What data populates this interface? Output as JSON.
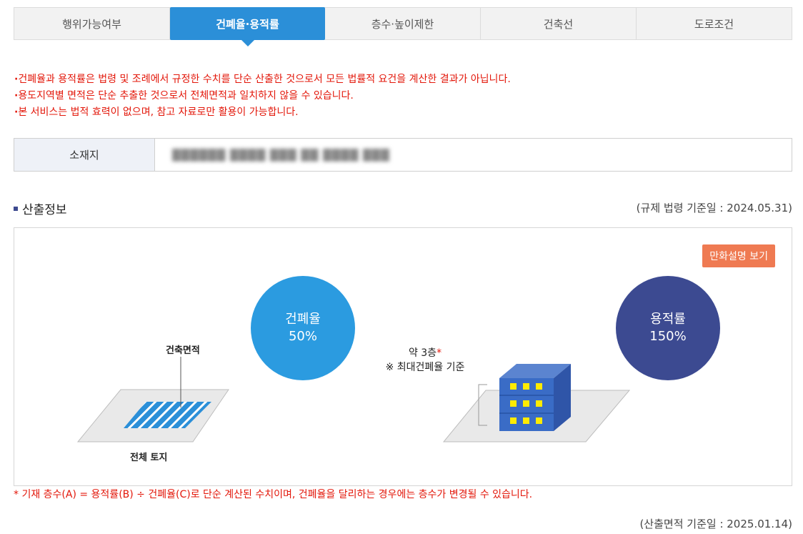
{
  "tabs": [
    {
      "label": "행위가능여부",
      "active": false
    },
    {
      "label": "건폐율·용적률",
      "active": true
    },
    {
      "label": "층수·높이제한",
      "active": false
    },
    {
      "label": "건축선",
      "active": false
    },
    {
      "label": "도로조건",
      "active": false
    }
  ],
  "notices": [
    "건폐율과 용적률은 법령 및 조례에서 규정한 수치를 단순 산출한 것으로서 모든 법률적 요건을 계산한 결과가 아닙니다.",
    "용도지역별 면적은 단순 추출한 것으로서 전체면적과 일치하지 않을 수 있습니다.",
    "본 서비스는 법적 효력이 없으며, 참고 자료로만 활용이 가능합니다."
  ],
  "location": {
    "label": "소재지",
    "value": "██████ ████ ███ ██ ████ ███"
  },
  "section": {
    "title": "산출정보",
    "basis_date": "(규제 법령 기준일 : 2024.05.31)"
  },
  "diagram": {
    "cartoon_button": "만화설명 보기",
    "bcr_label": "건폐율",
    "bcr_value": "50%",
    "far_label": "용적률",
    "far_value": "150%",
    "building_area_label": "건축면적",
    "total_land_label": "전체 토지",
    "floors_label": "약 3층",
    "floors_star": "*",
    "floors_note": "※ 최대건폐율 기준"
  },
  "footnote": "* 기재 층수(A) = 용적률(B) ÷ 건폐율(C)로 단순 계산된 수치이며, 건폐율을 달리하는 경우에는 층수가 변경될 수 있습니다.",
  "calc_date": "(산출면적 기준일 : 2025.01.14)",
  "colors": {
    "active_tab": "#2b8fd8",
    "notice_red": "#e3170a",
    "bcr_circle": "#2b9be0",
    "far_circle": "#3c4a91",
    "cartoon_button": "#ef7a52"
  }
}
